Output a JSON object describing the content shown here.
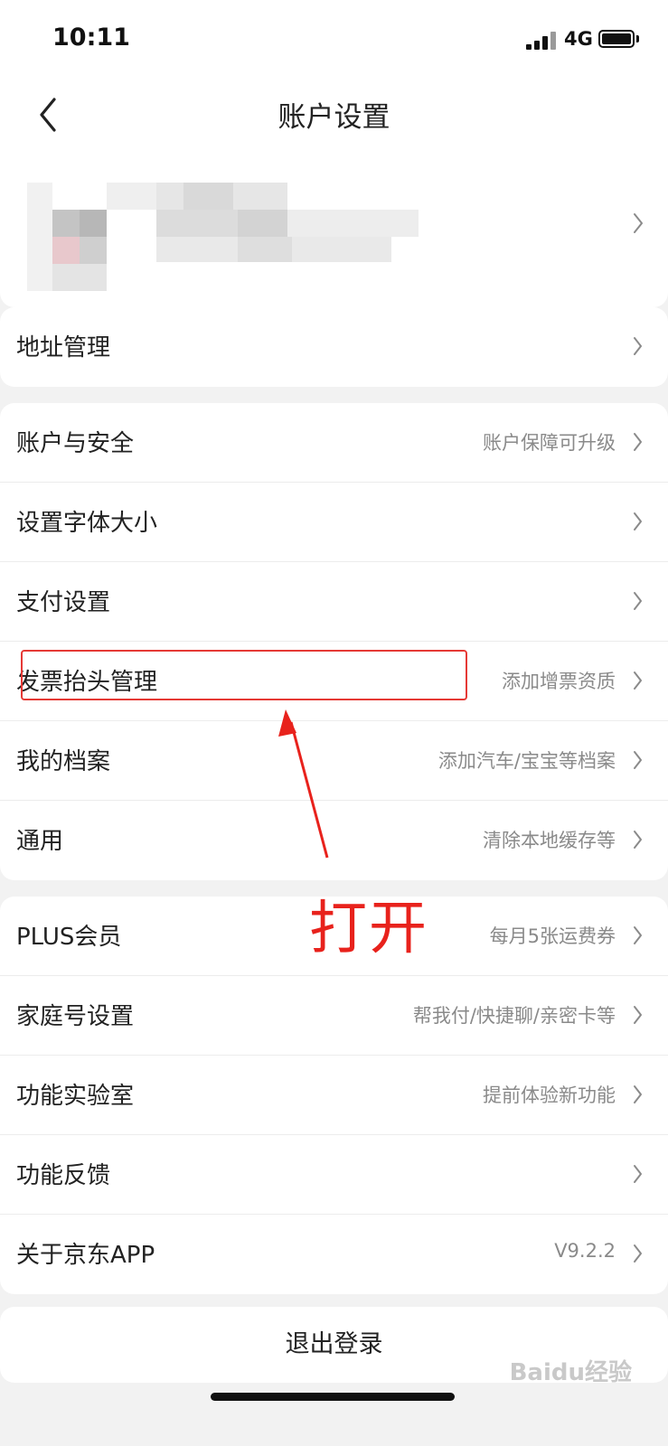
{
  "status": {
    "time": "10:11",
    "network": "4G"
  },
  "header": {
    "title": "账户设置"
  },
  "groups": [
    {
      "rows": [
        {
          "label": "地址管理",
          "sub": ""
        }
      ]
    },
    {
      "rows": [
        {
          "label": "账户与安全",
          "sub": "账户保障可升级"
        },
        {
          "label": "设置字体大小",
          "sub": ""
        },
        {
          "label": "支付设置",
          "sub": ""
        },
        {
          "label": "发票抬头管理",
          "sub": "添加增票资质"
        },
        {
          "label": "我的档案",
          "sub": "添加汽车/宝宝等档案"
        },
        {
          "label": "通用",
          "sub": "清除本地缓存等"
        }
      ]
    },
    {
      "rows": [
        {
          "label": "PLUS会员",
          "sub": "每月5张运费券"
        },
        {
          "label": "家庭号设置",
          "sub": "帮我付/快捷聊/亲密卡等"
        },
        {
          "label": "功能实验室",
          "sub": "提前体验新功能"
        },
        {
          "label": "功能反馈",
          "sub": ""
        },
        {
          "label": "关于京东APP",
          "sub": "V9.2.2"
        }
      ]
    }
  ],
  "logout": "退出登录",
  "annotation": {
    "text": "打开",
    "color": "#e8221c"
  },
  "watermark": "Baidu经验",
  "icons": [
    "back-chevron-icon",
    "chevron-right-icon",
    "signal-icon",
    "battery-icon"
  ]
}
